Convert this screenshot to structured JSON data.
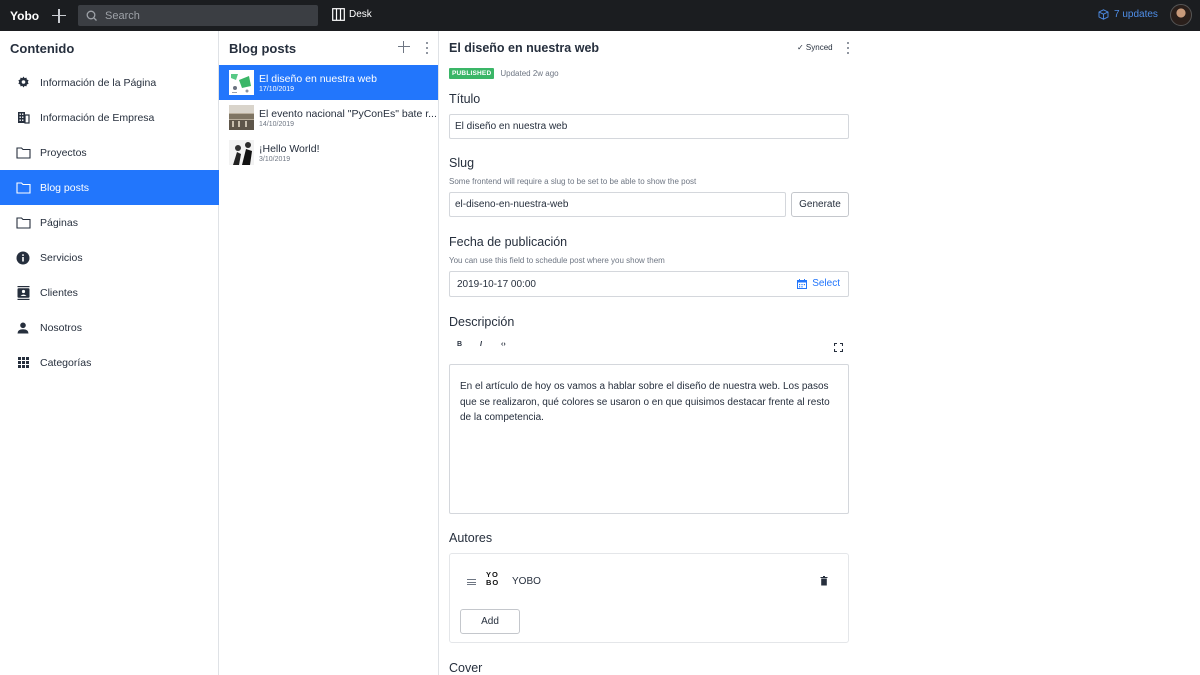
{
  "topbar": {
    "brand": "Yobo",
    "search_placeholder": "Search",
    "desk_label": "Desk",
    "updates_label": "7 updates"
  },
  "pane1": {
    "title": "Contenido",
    "items": [
      {
        "label": "Información de la Página",
        "icon": "gear-icon"
      },
      {
        "label": "Información de Empresa",
        "icon": "building-icon"
      },
      {
        "label": "Proyectos",
        "icon": "folder-icon"
      },
      {
        "label": "Blog posts",
        "icon": "folder-icon",
        "active": true
      },
      {
        "label": "Páginas",
        "icon": "folder-icon"
      },
      {
        "label": "Servicios",
        "icon": "info-icon"
      },
      {
        "label": "Clientes",
        "icon": "contact-card-icon"
      },
      {
        "label": "Nosotros",
        "icon": "person-icon"
      },
      {
        "label": "Categorías",
        "icon": "grid-icon"
      }
    ]
  },
  "pane2": {
    "title": "Blog posts",
    "documents": [
      {
        "title": "El diseño en nuestra web",
        "date": "17/10/2019",
        "active": true
      },
      {
        "title": "El evento nacional \"PyConEs\" bate r...",
        "date": "14/10/2019"
      },
      {
        "title": "¡Hello World!",
        "date": "3/10/2019"
      }
    ]
  },
  "editor": {
    "heading": "El diseño en nuestra web",
    "sync_status": "✓ Synced",
    "badge": "PUBLISHED",
    "updated": "Updated 2w ago",
    "titulo_label": "Título",
    "titulo_value": "El diseño en nuestra web",
    "slug_label": "Slug",
    "slug_desc": "Some frontend will require a slug to be set to be able to show the post",
    "slug_value": "el-diseno-en-nuestra-web",
    "generate_label": "Generate",
    "fecha_label": "Fecha de publicación",
    "fecha_desc": "You can use this field to schedule post where you show them",
    "fecha_value": "2019-10-17 00:00",
    "select_label": "Select",
    "descripcion_label": "Descripción",
    "toolbar": {
      "bold": "B",
      "italic": "I",
      "code": "‹›"
    },
    "descripcion_text": "En el artículo de hoy os vamos a hablar sobre el diseño de nuestra web. Los pasos que se realizaron, qué colores se usaron o en que quisimos destacar frente al resto de la competencia.",
    "autores_label": "Autores",
    "author_logo": "YO BO",
    "author_name": "YOBO",
    "add_label": "Add",
    "cover_label": "Cover"
  },
  "colors": {
    "accent": "#2276fc",
    "published": "#3ab667",
    "topbar": "#1b1d20"
  }
}
